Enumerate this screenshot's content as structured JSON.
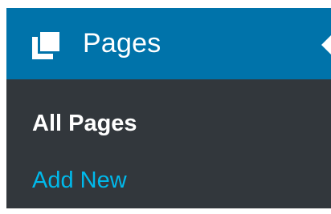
{
  "menu": {
    "header": {
      "icon": "pages-icon",
      "title": "Pages"
    },
    "submenu": [
      {
        "label": "All Pages",
        "current": true
      },
      {
        "label": "Add New",
        "current": false
      }
    ]
  },
  "colors": {
    "header_bg": "#0073aa",
    "menu_bg": "#32373c",
    "current_text": "#ffffff",
    "link_text": "#00b9eb"
  }
}
